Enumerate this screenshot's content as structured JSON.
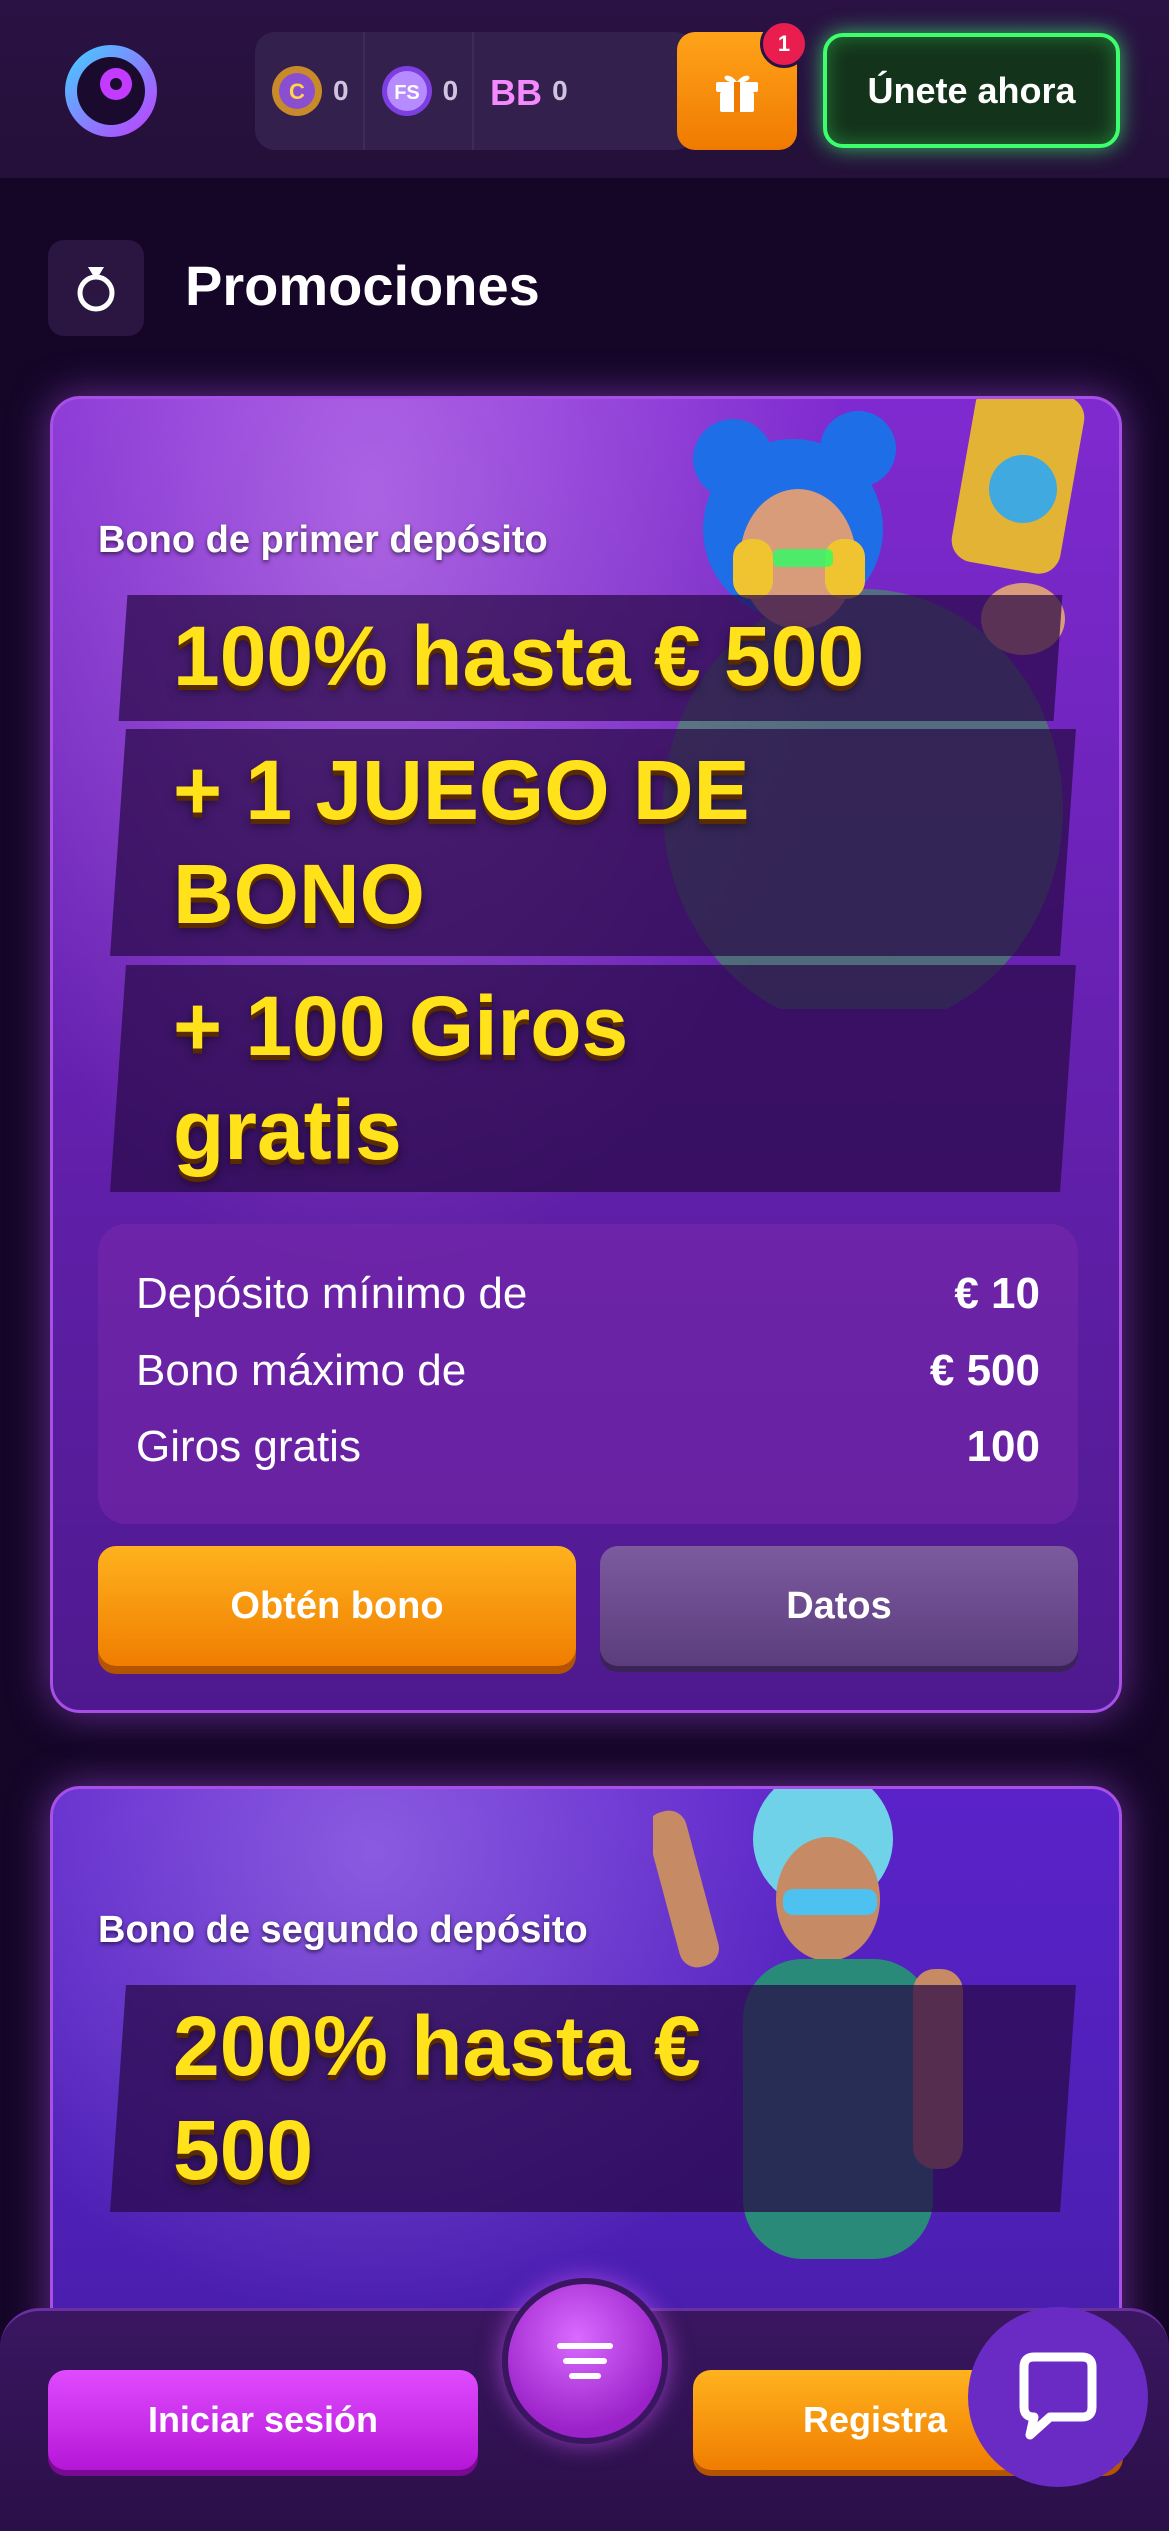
{
  "header": {
    "wallet": [
      {
        "icon": "coin-icon",
        "count": "0"
      },
      {
        "icon": "free-spins-icon",
        "count": "0"
      },
      {
        "icon": "bonus-buy-icon",
        "count": "0"
      }
    ],
    "gift_badge": "1",
    "join_label": "Únete ahora"
  },
  "page": {
    "title": "Promociones"
  },
  "promos": [
    {
      "label": "Bono de primer depósito",
      "headline_lines": [
        "100% hasta € 500",
        "+ 1 JUEGO DE",
        "BONO",
        "+ 100 Giros",
        "gratis"
      ],
      "details": [
        {
          "key": "Depósito mínimo de",
          "value": "€ 10"
        },
        {
          "key": "Bono máximo de",
          "value": "€ 500"
        },
        {
          "key": "Giros gratis",
          "value": "100"
        }
      ],
      "primary_label": "Obtén bono",
      "secondary_label": "Datos"
    },
    {
      "label": "Bono de segundo depósito",
      "headline_lines": [
        "200% hasta €",
        "500"
      ]
    }
  ],
  "bottom_bar": {
    "login_label": "Iniciar sesión",
    "register_label": "Registra"
  },
  "colors": {
    "accent_yellow": "#ffe21a",
    "join_green": "#3dff6d",
    "orange": "#f07d00",
    "magenta": "#b516d6"
  }
}
